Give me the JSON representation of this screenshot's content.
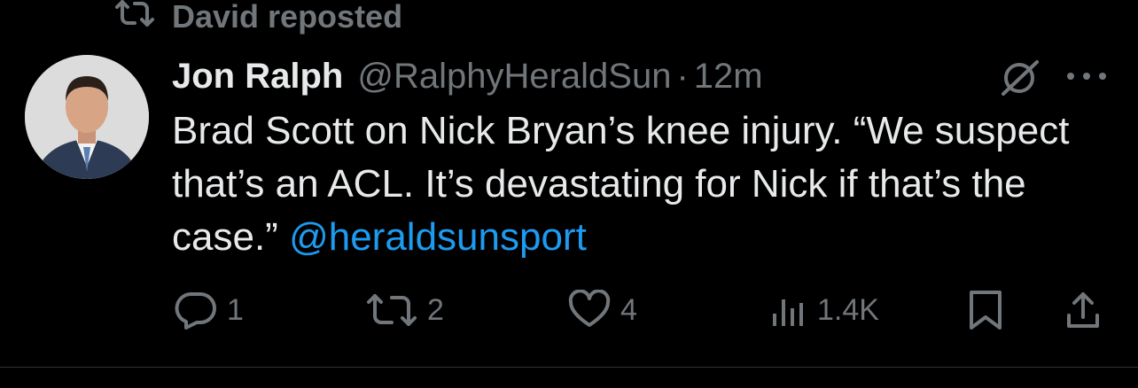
{
  "repost_banner": {
    "text": "David reposted"
  },
  "tweet": {
    "author_name": "Jon Ralph",
    "handle": "@RalphyHeraldSun",
    "separator": "·",
    "timestamp": "12m",
    "text": "Brad Scott on Nick Bryan’s knee injury. “We suspect that’s an ACL. It’s devastating for Nick if that’s the case.”",
    "mention": "@heraldsunsport"
  },
  "actions": {
    "reply_count": "1",
    "repost_count": "2",
    "like_count": "4",
    "views_count": "1.4K"
  },
  "colors": {
    "background": "#000000",
    "text": "#e7e9ea",
    "muted": "#71767b",
    "link": "#1d9bf0"
  },
  "icons": [
    "repost-icon",
    "grok-icon",
    "more-icon",
    "reply-icon",
    "like-icon",
    "views-icon",
    "bookmark-icon",
    "share-icon"
  ]
}
